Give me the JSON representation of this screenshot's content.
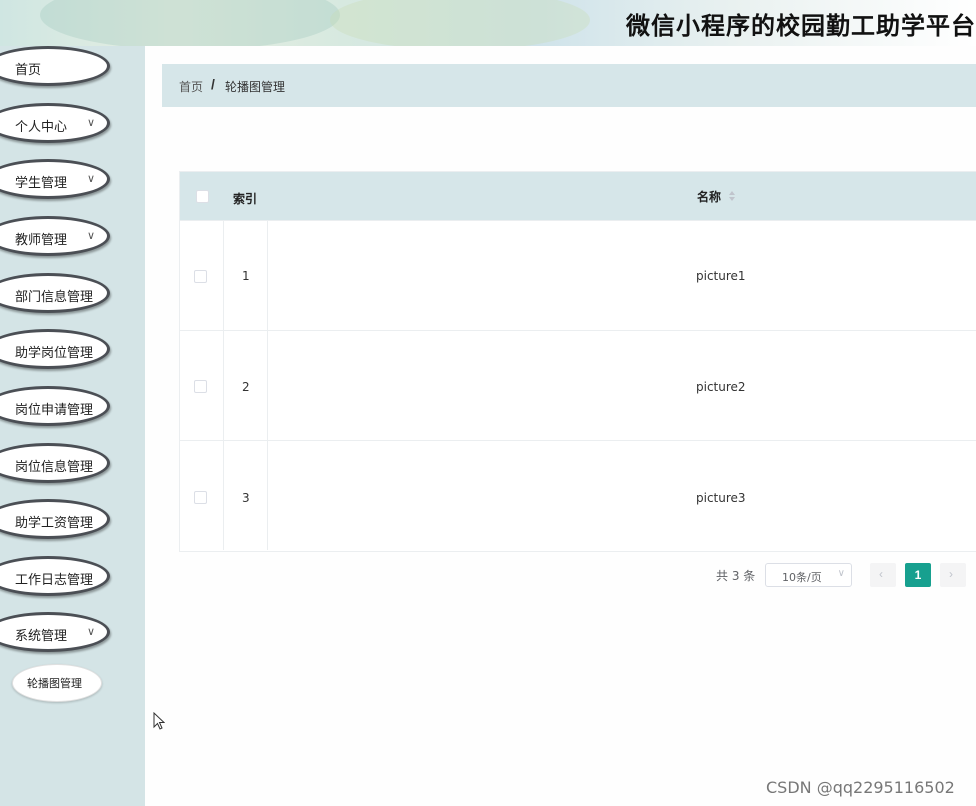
{
  "header": {
    "title": "微信小程序的校园勤工助学平台"
  },
  "sidebar": {
    "items": [
      {
        "label": "首页",
        "has_chevron": false
      },
      {
        "label": "个人中心",
        "has_chevron": true
      },
      {
        "label": "学生管理",
        "has_chevron": true
      },
      {
        "label": "教师管理",
        "has_chevron": true
      },
      {
        "label": "部门信息管理",
        "has_chevron": false
      },
      {
        "label": "助学岗位管理",
        "has_chevron": false
      },
      {
        "label": "岗位申请管理",
        "has_chevron": false
      },
      {
        "label": "岗位信息管理",
        "has_chevron": false
      },
      {
        "label": "助学工资管理",
        "has_chevron": false
      },
      {
        "label": "工作日志管理",
        "has_chevron": false
      },
      {
        "label": "系统管理",
        "has_chevron": true
      }
    ],
    "submenu": {
      "label": "轮播图管理"
    }
  },
  "breadcrumb": {
    "home": "首页",
    "separator": "/",
    "current": "轮播图管理"
  },
  "table": {
    "headers": {
      "index": "索引",
      "name": "名称"
    },
    "rows": [
      {
        "index": "1",
        "name": "picture1"
      },
      {
        "index": "2",
        "name": "picture2"
      },
      {
        "index": "3",
        "name": "picture3"
      }
    ]
  },
  "pagination": {
    "total": "共 3 条",
    "page_size": "10条/页",
    "current_page": "1",
    "prev_icon": "chevron-left-icon",
    "next_icon": "chevron-right-icon"
  },
  "watermark": "CSDN @qq2295116502",
  "colors": {
    "accent": "#17a08f",
    "sidebar_bg": "#d4e4e6",
    "header_row_bg": "#d6e6e9"
  }
}
